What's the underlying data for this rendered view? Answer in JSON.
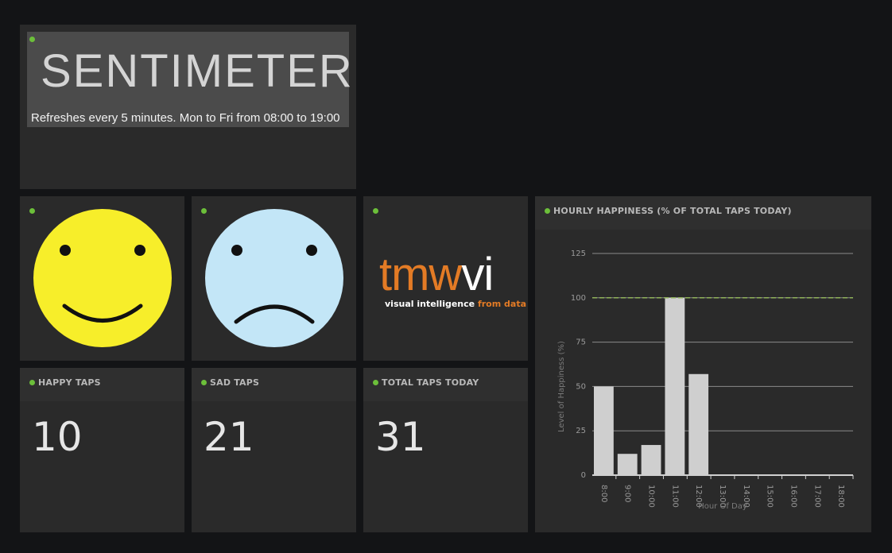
{
  "header": {
    "title": "SENTIMETER",
    "subtitle": "Refreshes every 5 minutes. Mon to Fri from 08:00 to 19:00"
  },
  "faces": {
    "happy": "happy-face-icon",
    "sad": "sad-face-icon"
  },
  "logo": {
    "tmw": "tmw",
    "vi": "vi",
    "tagline_main": "visual intelligence",
    "tagline_end": "from data"
  },
  "stats": {
    "happy": {
      "label": "HAPPY TAPS",
      "value": "10"
    },
    "sad": {
      "label": "SAD TAPS",
      "value": "21"
    },
    "total": {
      "label": "TOTAL TAPS TODAY",
      "value": "31"
    }
  },
  "colors": {
    "status_dot": "#6cbf3a",
    "happy_face": "#f7ee2a",
    "sad_face": "#c3e6f7",
    "logo_orange": "#e37b25",
    "bar": "#cfcfcf",
    "target_line": "#8fb15a"
  },
  "chart_data": {
    "type": "bar",
    "title": "HOURLY HAPPINESS (% OF TOTAL TAPS TODAY)",
    "xlabel": "Hour Of Day",
    "ylabel": "Level of Happiness (%)",
    "categories": [
      "8:00",
      "9:00",
      "10:00",
      "11:00",
      "12:00",
      "13:00",
      "14:00",
      "15:00",
      "16:00",
      "17:00",
      "18:00"
    ],
    "values": [
      50,
      12,
      17,
      100,
      57,
      0,
      0,
      0,
      0,
      0,
      0
    ],
    "ylim": [
      0,
      125
    ],
    "yticks": [
      0,
      25,
      50,
      75,
      100,
      125
    ],
    "reference_line": 100,
    "grid": true
  }
}
